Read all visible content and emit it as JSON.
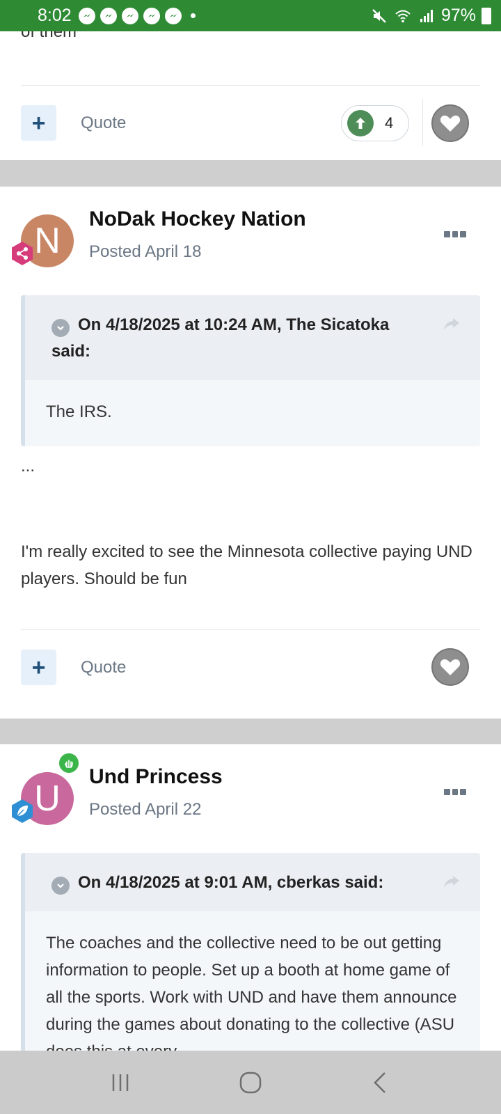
{
  "status_bar": {
    "time": "8:02",
    "battery": "97%"
  },
  "post_previous": {
    "partial_text": "of them",
    "quote_label": "Quote",
    "reaction_count": "4"
  },
  "post_nodak": {
    "author": "NoDak Hockey Nation",
    "avatar_letter": "N",
    "posted": "Posted April 18",
    "quote_header": "On 4/18/2025 at 10:24 AM, The Sicatoka said:",
    "quote_body": "The IRS.",
    "ellipsis": "...",
    "body": "I'm really excited to see the Minnesota collective paying UND players. Should be fun",
    "quote_label": "Quote"
  },
  "post_und": {
    "author": "Und Princess",
    "avatar_letter": "U",
    "posted": "Posted April 22",
    "quote_header": "On 4/18/2025 at 9:01 AM, cberkas said:",
    "quote_body": "The coaches and the collective need to be out getting information to people. Set up a booth at home game of all the sports. Work with UND and have them announce during the games about donating to the collective (ASU does this at every"
  },
  "colors": {
    "status_bar": "#2e8b34",
    "avatar_nodak": "#c98665",
    "avatar_und": "#c9689c",
    "upvote": "#4e8d57"
  }
}
